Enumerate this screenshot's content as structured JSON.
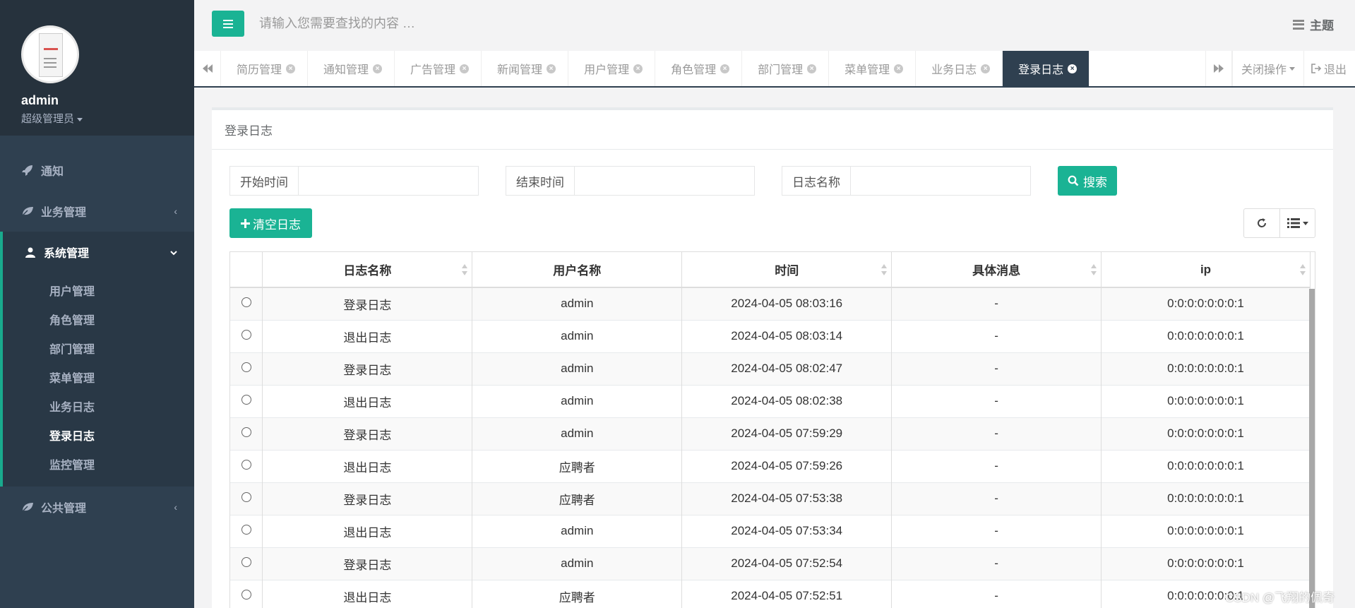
{
  "profile": {
    "name": "admin",
    "role": "超级管理员"
  },
  "sidebar": {
    "items": [
      {
        "label": "通知",
        "icon": "rocket-icon"
      },
      {
        "label": "业务管理",
        "icon": "leaf-icon"
      },
      {
        "label": "系统管理",
        "icon": "user-icon"
      },
      {
        "label": "公共管理",
        "icon": "leaf-icon"
      }
    ],
    "system_sub": [
      "用户管理",
      "角色管理",
      "部门管理",
      "菜单管理",
      "业务日志",
      "登录日志",
      "监控管理"
    ]
  },
  "topbar": {
    "search_placeholder": "请输入您需要查找的内容 …",
    "theme_label": "主题"
  },
  "tabs": [
    "简历管理",
    "通知管理",
    "广告管理",
    "新闻管理",
    "用户管理",
    "角色管理",
    "部门管理",
    "菜单管理",
    "业务日志",
    "登录日志"
  ],
  "tab_actions": {
    "close_ops": "关闭操作",
    "logout": "退出"
  },
  "panel": {
    "title": "登录日志"
  },
  "filters": {
    "start_label": "开始时间",
    "end_label": "结束时间",
    "name_label": "日志名称",
    "search_btn": "搜索",
    "clear_btn": "清空日志"
  },
  "table": {
    "headers": [
      "日志名称",
      "用户名称",
      "时间",
      "具体消息",
      "ip"
    ],
    "rows": [
      [
        "登录日志",
        "admin",
        "2024-04-05 08:03:16",
        "-",
        "0:0:0:0:0:0:0:1"
      ],
      [
        "退出日志",
        "admin",
        "2024-04-05 08:03:14",
        "-",
        "0:0:0:0:0:0:0:1"
      ],
      [
        "登录日志",
        "admin",
        "2024-04-05 08:02:47",
        "-",
        "0:0:0:0:0:0:0:1"
      ],
      [
        "退出日志",
        "admin",
        "2024-04-05 08:02:38",
        "-",
        "0:0:0:0:0:0:0:1"
      ],
      [
        "登录日志",
        "admin",
        "2024-04-05 07:59:29",
        "-",
        "0:0:0:0:0:0:0:1"
      ],
      [
        "退出日志",
        "应聘者",
        "2024-04-05 07:59:26",
        "-",
        "0:0:0:0:0:0:0:1"
      ],
      [
        "登录日志",
        "应聘者",
        "2024-04-05 07:53:38",
        "-",
        "0:0:0:0:0:0:0:1"
      ],
      [
        "退出日志",
        "admin",
        "2024-04-05 07:53:34",
        "-",
        "0:0:0:0:0:0:0:1"
      ],
      [
        "登录日志",
        "admin",
        "2024-04-05 07:52:54",
        "-",
        "0:0:0:0:0:0:0:1"
      ],
      [
        "退出日志",
        "应聘者",
        "2024-04-05 07:52:51",
        "-",
        "0:0:0:0:0:0:0:1"
      ]
    ]
  },
  "watermark": "CSDN @飞翔的佩奇",
  "colors": {
    "accent": "#1ab394",
    "sidebar_bg": "#2f4050"
  }
}
